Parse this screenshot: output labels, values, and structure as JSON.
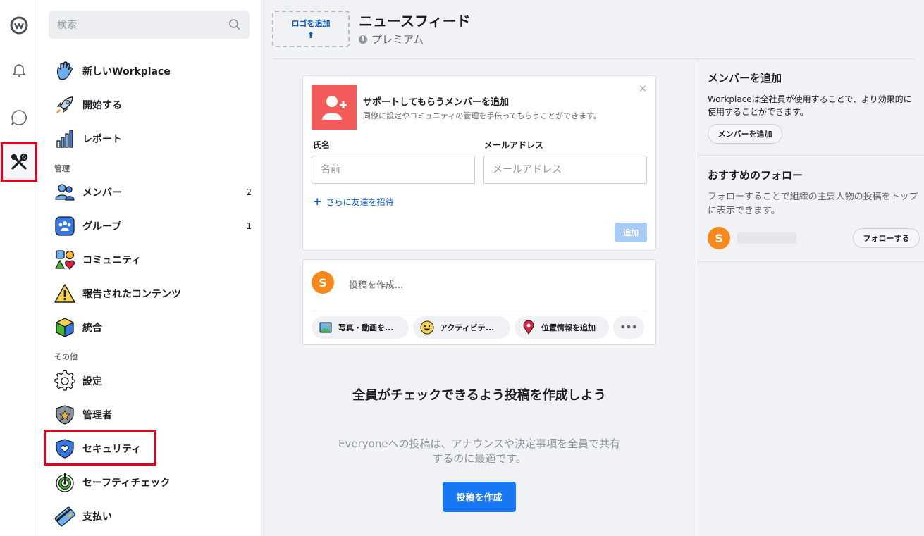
{
  "rail": {
    "items": [
      {
        "name": "workplace-logo-icon"
      },
      {
        "name": "bell-icon"
      },
      {
        "name": "chat-icon"
      },
      {
        "name": "tools-icon",
        "active": true
      }
    ]
  },
  "sidebar": {
    "search_placeholder": "検索",
    "items": [
      {
        "label": "新しいWorkplace",
        "icon": "wave-hand-icon"
      },
      {
        "label": "開始する",
        "icon": "rocket-icon"
      },
      {
        "label": "レポート",
        "icon": "bar-chart-icon"
      },
      {
        "label": "メンバー",
        "icon": "people-icon",
        "count": "2"
      },
      {
        "label": "グループ",
        "icon": "group-icon",
        "count": "1"
      },
      {
        "label": "コミュニティ",
        "icon": "shapes-icon"
      },
      {
        "label": "報告されたコンテンツ",
        "icon": "warning-icon"
      },
      {
        "label": "統合",
        "icon": "cube-icon"
      },
      {
        "label": "設定",
        "icon": "gear-icon"
      },
      {
        "label": "管理者",
        "icon": "admin-shield-icon"
      },
      {
        "label": "セキュリティ",
        "icon": "security-shield-icon"
      },
      {
        "label": "セーフティチェック",
        "icon": "safety-check-icon"
      },
      {
        "label": "支払い",
        "icon": "credit-card-icon"
      }
    ],
    "sections": {
      "manage": "管理",
      "other": "その他"
    }
  },
  "header": {
    "logo_label": "ロゴを追加",
    "logo_arrow": "⬆",
    "title": "ニュースフィード",
    "premium": "プレミアム",
    "premium_icon": "i"
  },
  "invite": {
    "title": "サポートしてもらうメンバーを追加",
    "subtitle": "同僚に設定やコミュニティの管理を手伝ってもらうことができます。",
    "close": "×",
    "name_label": "氏名",
    "name_placeholder": "名前",
    "email_label": "メールアドレス",
    "email_placeholder": "メールアドレス",
    "invite_more": "さらに友達を招待",
    "invite_more_icon": "+",
    "add_button": "追加"
  },
  "composer": {
    "avatar_letter": "S",
    "placeholder": "投稿を作成...",
    "actions": [
      {
        "label": "写真・動画を...",
        "icon": "photo-icon"
      },
      {
        "label": "アクティビテ...",
        "icon": "smiley-icon"
      },
      {
        "label": "位置情報を追加",
        "icon": "location-pin-icon"
      }
    ],
    "more": "•••"
  },
  "empty": {
    "title": "全員がチェックできるよう投稿を作成しよう",
    "subtitle": "Everyoneへの投稿は、アナウンスや決定事項を全員で共有するのに最適です。",
    "cta": "投稿を作成"
  },
  "right": {
    "add_members_title": "メンバーを追加",
    "add_members_text": "Workplaceは全社員が使用することで、より効果的に使用することができます。",
    "add_members_button": "メンバーを追加",
    "follow_title": "おすすめのフォロー",
    "follow_text": "フォローすることで組織の主要人物の投稿をトップに表示できます。",
    "follow_avatar": "S",
    "follow_button": "フォローする"
  },
  "colors": {
    "accent": "#1877f2",
    "highlight": "#e4001b",
    "invite_avatar": "#f35b5b",
    "avatar": "#f7891b"
  }
}
